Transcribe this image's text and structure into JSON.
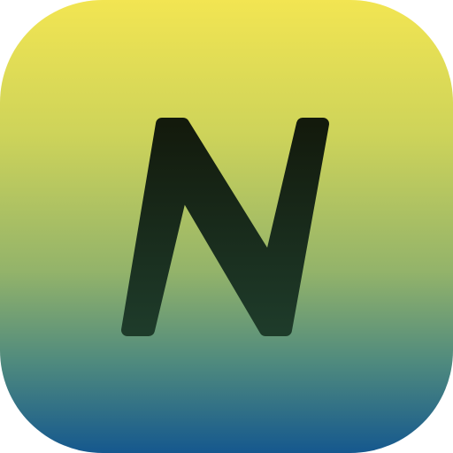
{
  "app_icon": {
    "letter": "N",
    "icon_name": "letter-n-logo-icon",
    "colors": {
      "gradient_top": "#F2E552",
      "gradient_upper_mid": "#CDD35A",
      "gradient_mid": "#93B36A",
      "gradient_lower_mid": "#4F8A7E",
      "gradient_bottom": "#15588E",
      "glyph_top": "#131A0C",
      "glyph_bottom": "#1E3B2A"
    }
  }
}
